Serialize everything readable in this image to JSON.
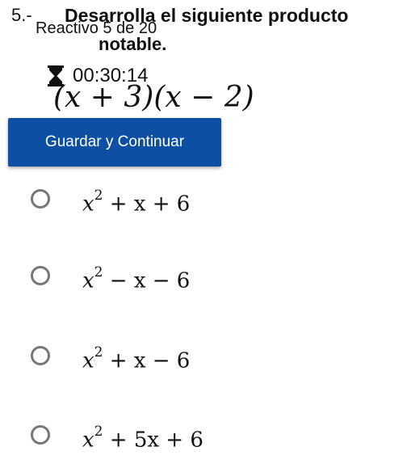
{
  "question": {
    "number": "5.-",
    "title_line1": "Desarrolla el siguiente producto",
    "title_line2": "notable.",
    "counter": "Reactivo 5 de 20",
    "timer": "00:30:14",
    "expression": "(x + 3)(x − 2)"
  },
  "icons": {
    "timer": "hourglass-icon",
    "radio": "radio-circle-icon"
  },
  "colors": {
    "button_bg": "#0d4fa3",
    "button_text": "#ffffff"
  },
  "actions": {
    "save_label": "Guardar y Continuar"
  },
  "options": [
    {
      "base": "x",
      "exp": "2",
      "rest": " + x + 6"
    },
    {
      "base": "x",
      "exp": "2",
      "rest": " − x − 6"
    },
    {
      "base": "x",
      "exp": "2",
      "rest": " + x − 6"
    },
    {
      "base": "x",
      "exp": "2",
      "rest": " + 5x + 6"
    }
  ]
}
